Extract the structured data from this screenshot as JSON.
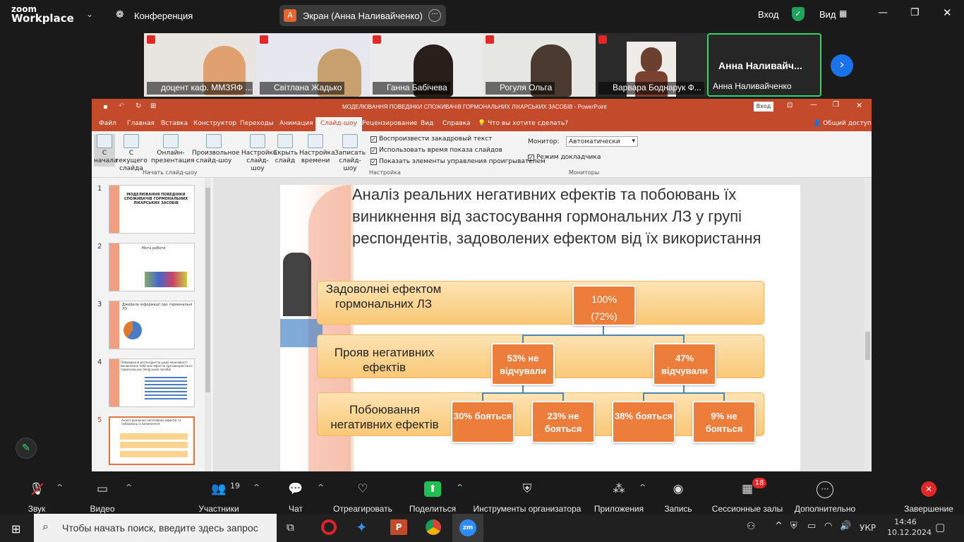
{
  "zoom": {
    "brand_top": "zoom",
    "brand_bottom": "Workplace",
    "meeting_label": "Конференция",
    "share_label": "Экран (Анна Наливайченко)",
    "share_avatar": "А",
    "signin": "Вход",
    "view": "Вид",
    "participants": [
      {
        "name": "доцент каф. ММЗЯФ ..."
      },
      {
        "name": "Світлана Жадько"
      },
      {
        "name": "Ганна Бабічева"
      },
      {
        "name": "Рогуля Ольга"
      },
      {
        "name": "Варвара Боднарук Ф..."
      },
      {
        "name": "Анна Наливайченко",
        "display": "Анна  Наливайч..."
      }
    ],
    "toolbar": {
      "audio": "Звук",
      "video": "Видео",
      "participants": "Участники",
      "participants_count": "19",
      "chat": "Чат",
      "react": "Отреагировать",
      "share": "Поделиться",
      "host_tools": "Инструменты организатора",
      "apps": "Приложения",
      "record": "Запись",
      "breakout": "Сессионные залы",
      "breakout_badge": "18",
      "more": "Дополнительно",
      "end": "Завершение"
    }
  },
  "ppt": {
    "window_title": "МОДЕЛЮВАННЯ ПОВЕДІНКИ СПОЖИВАЧІВ ГОРМОНАЛЬНИХ ЛІКАРСЬКИХ ЗАСОБІВ  -  PowerPoint",
    "signin": "Вход",
    "tabs": [
      "Файл",
      "Главная",
      "Вставка",
      "Конструктор",
      "Переходы",
      "Анимация",
      "Слайд-шоу",
      "Рецензирование",
      "Вид",
      "Справка"
    ],
    "tellme": "Что вы хотите сделать?",
    "share": "Общий доступ",
    "ribbon": {
      "from_start": "С начала",
      "from_current": "С текущего слайда",
      "online": "Онлайн-презентация",
      "custom": "Произвольное слайд-шоу",
      "group_start": "Начать слайд-шоу",
      "setup": "Настройка слайд-шоу",
      "hide": "Скрыть слайд",
      "rehearse": "Настройка времени",
      "record": "Записать слайд-шоу",
      "chk1": "Воспроизвести закадровый текст",
      "chk2": "Использовать время показа слайдов",
      "chk3": "Показать элементы управления проигрывателем",
      "group_setup": "Настройка",
      "monitor_label": "Монитор:",
      "monitor_value": "Автоматически",
      "presenter": "Режим докладчика",
      "group_monitors": "Мониторы"
    },
    "thumbs": [
      {
        "num": "1",
        "title": "МОДЕЛЮВАННЯ ПОВЕДІНКИ СПОЖИВАЧІВ ГОРМОНАЛЬНИХ ЛІКАРСЬКИХ ЗАСОБІВ"
      },
      {
        "num": "2",
        "title": "Мета роботи"
      },
      {
        "num": "3",
        "title": "Джерела інформації про гормональні ЛЗ"
      },
      {
        "num": "4",
        "title": "Побоювання респондентів щодо можливості виникнення побічних ефектів при використанні гормональних лікарських засобів"
      },
      {
        "num": "5",
        "title": "Аналіз реальних негативних ефектів та побоювань їх виникнення"
      }
    ],
    "slide": {
      "title": "Аналіз реальних негативних ефектів та побоювань їх виникнення від застосування гормональних ЛЗ у групі респондентів, задоволених ефектом від їх використання",
      "row1_label": "Задоволнеі ефектом гормональних ЛЗ",
      "row2_label": "Прояв негативних ефектів",
      "row3_label": "Побоювання негативних ефектів",
      "b1a": "100%",
      "b1b": "(72%)",
      "b2": "53% не відчували",
      "b3": "47% відчували",
      "b4": "30% бояться",
      "b5": "23% не бояться",
      "b6": "38% бояться",
      "b7": "9% не бояться"
    }
  },
  "taskbar": {
    "search_placeholder": "Чтобы начать поиск, введите здесь запрос",
    "lang": "УКР",
    "time": "14:46",
    "date": "10.12.2024"
  }
}
